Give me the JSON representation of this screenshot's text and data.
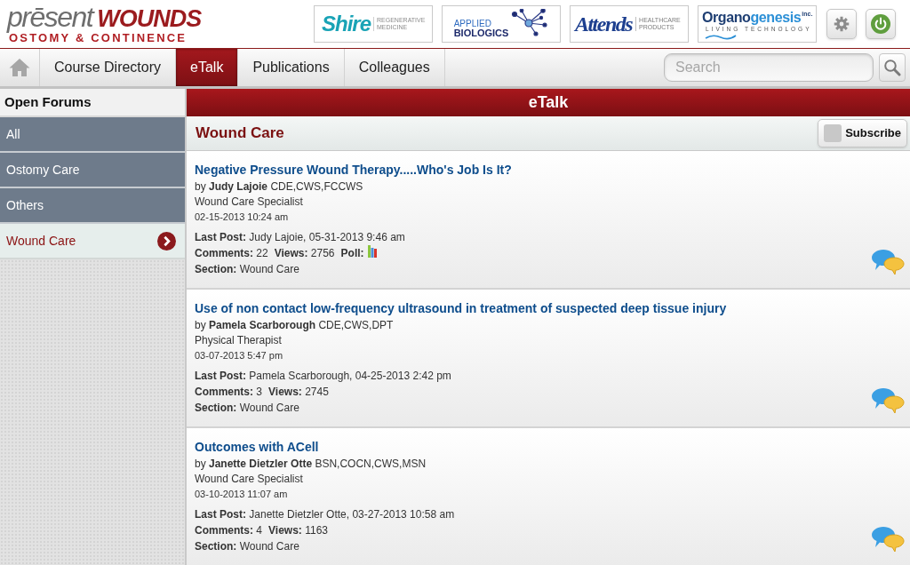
{
  "header": {
    "logo": {
      "first_word": "prēsent",
      "second_word": "WOUNDS",
      "tagline": "OSTOMY & CONTINENCE"
    },
    "sponsors": [
      {
        "kind": "shire",
        "name": "Shire",
        "tagline": "REGENERATIVE MEDICINE"
      },
      {
        "kind": "applied_biologics",
        "name_lines": [
          "APPLIED",
          "BIOLOGICS"
        ]
      },
      {
        "kind": "attends",
        "name": "Attends",
        "tagline": "HEALTHCARE PRODUCTS"
      },
      {
        "kind": "organogenesis",
        "name_parts": [
          "Organo",
          "genesis"
        ],
        "suffix": "inc.",
        "tagline": "LIVING TECHNOLOGY"
      }
    ]
  },
  "nav": {
    "tabs": [
      {
        "label": "Course Directory",
        "selected": false
      },
      {
        "label": "eTalk",
        "selected": true
      },
      {
        "label": "Publications",
        "selected": false
      },
      {
        "label": "Colleagues",
        "selected": false
      }
    ],
    "search": {
      "placeholder": "Search"
    }
  },
  "sidebar": {
    "title": "Open Forums",
    "items": [
      {
        "label": "All",
        "selected": false
      },
      {
        "label": "Ostomy Care",
        "selected": false
      },
      {
        "label": "Others",
        "selected": false
      },
      {
        "label": "Wound Care",
        "selected": true
      }
    ]
  },
  "main": {
    "title": "eTalk",
    "forum_title": "Wound Care",
    "subscribe": {
      "label": "Subscribe",
      "checked": false
    },
    "posts": [
      {
        "title": "Negative Pressure Wound Therapy.....Who's Job Is It?",
        "byline": "by **Judy Lajoie** CDE,CWS,FCCWS",
        "role": "Wound Care Specialist",
        "date": "02-15-2013 10:24 am",
        "last_post": "**Last Post:** Judy Lajoie, 05-31-2013 9:46 am",
        "stats": [
          {
            "kind": "count",
            "text": "**Comments:** 22"
          },
          {
            "kind": "count",
            "text": "**Views:** 2756"
          },
          {
            "kind": "poll",
            "text": "Poll:"
          }
        ],
        "section": "**Section:** Wound Care"
      },
      {
        "title": "Use of non contact low-frequency ultrasound in treatment of suspected deep tissue injury",
        "byline": "by **Pamela Scarborough** CDE,CWS,DPT",
        "role": "Physical Therapist",
        "date": "03-07-2013 5:47 pm",
        "last_post": "**Last Post:** Pamela Scarborough, 04-25-2013 2:42 pm",
        "stats": [
          {
            "kind": "count",
            "text": "**Comments:** 3"
          },
          {
            "kind": "count",
            "text": "**Views:** 2745"
          }
        ],
        "section": "**Section:** Wound Care"
      },
      {
        "title": "Outcomes with ACell",
        "byline": "by **Janette Dietzler Otte** BSN,COCN,CWS,MSN",
        "role": "Wound Care Specialist",
        "date": "03-10-2013 11:07 am",
        "last_post": "**Last Post:** Janette Dietzler Otte, 03-27-2013 10:58 am",
        "stats": [
          {
            "kind": "count",
            "text": "**Comments:** 4"
          },
          {
            "kind": "count",
            "text": "**Views:** 1163"
          }
        ],
        "section": "**Section:** Wound Care"
      }
    ]
  }
}
